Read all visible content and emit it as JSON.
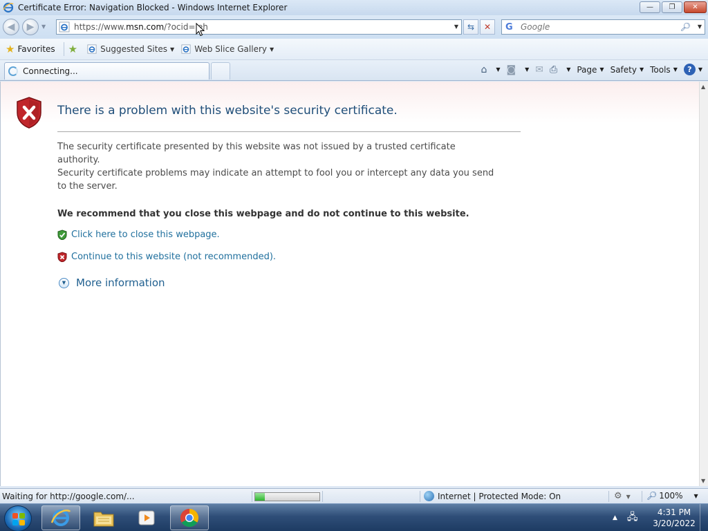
{
  "window": {
    "title": "Certificate Error: Navigation Blocked - Windows Internet Explorer",
    "minimize_symbol": "—",
    "maximize_symbol": "❐",
    "close_symbol": "✕"
  },
  "address_bar": {
    "url_prefix": "https://www.",
    "url_host": "msn.com",
    "url_rest": "/?ocid=ieh",
    "refresh_symbol": "⇆",
    "stop_symbol": "✕"
  },
  "search": {
    "provider_glyph": "G",
    "placeholder": "Google"
  },
  "favorites_bar": {
    "favorites_label": "Favorites",
    "links": [
      {
        "label": "Suggested Sites"
      },
      {
        "label": "Web Slice Gallery"
      }
    ]
  },
  "tab": {
    "label": "Connecting..."
  },
  "command_bar": {
    "page_label": "Page",
    "safety_label": "Safety",
    "tools_label": "Tools",
    "help_glyph": "?"
  },
  "page": {
    "heading": "There is a problem with this website's security certificate.",
    "para1": "The security certificate presented by this website was not issued by a trusted certificate authority.",
    "para2": "Security certificate problems may indicate an attempt to fool you or intercept any data you send to the server.",
    "recommendation": "We recommend that you close this webpage and do not continue to this website.",
    "close_option": "Click here to close this webpage.",
    "continue_option": "Continue to this website (not recommended).",
    "more_info": "More information"
  },
  "status_bar": {
    "status_text": "Waiting for http://google.com/...",
    "progress_fraction": 0.15,
    "zone_text": "Internet | Protected Mode: On",
    "zoom": "100%"
  },
  "taskbar": {
    "items": [
      "internet-explorer",
      "windows-explorer",
      "media-player",
      "chrome"
    ],
    "clock_time": "4:31 PM",
    "clock_date": "3/20/2022"
  },
  "colors": {
    "heading": "#1f4e79",
    "link": "#1f6f9d",
    "error_red": "#c0262b",
    "ok_green": "#3f9b3a"
  }
}
